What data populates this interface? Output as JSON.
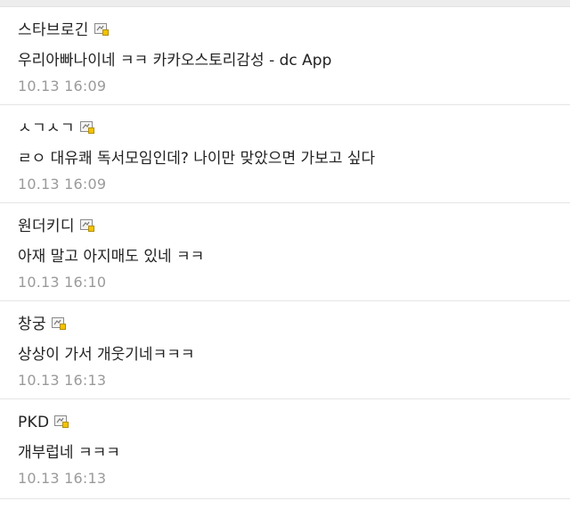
{
  "comments": [
    {
      "author": "스타브로긴",
      "text": "우리아빠나이네 ㅋㅋ 카카오스토리감성 - dc App",
      "time": "10.13 16:09",
      "badge_icon": "member-gallog-icon"
    },
    {
      "author": "ㅅㄱㅅㄱ",
      "text": "ㄹㅇ 대유쾌 독서모임인데? 나이만 맞았으면 가보고 싶다",
      "time": "10.13 16:09",
      "badge_icon": "member-gallog-icon"
    },
    {
      "author": "원더키디",
      "text": "아재 말고 아지매도 있네 ㅋㅋ",
      "time": "10.13 16:10",
      "badge_icon": "member-gallog-icon"
    },
    {
      "author": "창궁",
      "text": "상상이 가서 개웃기네ㅋㅋㅋ",
      "time": "10.13 16:13",
      "badge_icon": "member-gallog-icon"
    },
    {
      "author": "PKD",
      "text": "개부럽네 ㅋㅋㅋ",
      "time": "10.13 16:13",
      "badge_icon": "member-gallog-icon"
    }
  ],
  "colors": {
    "text": "#222222",
    "timestamp": "#9a9a9a",
    "divider": "#e5e5e5",
    "badge_accent": "#f2c200"
  }
}
